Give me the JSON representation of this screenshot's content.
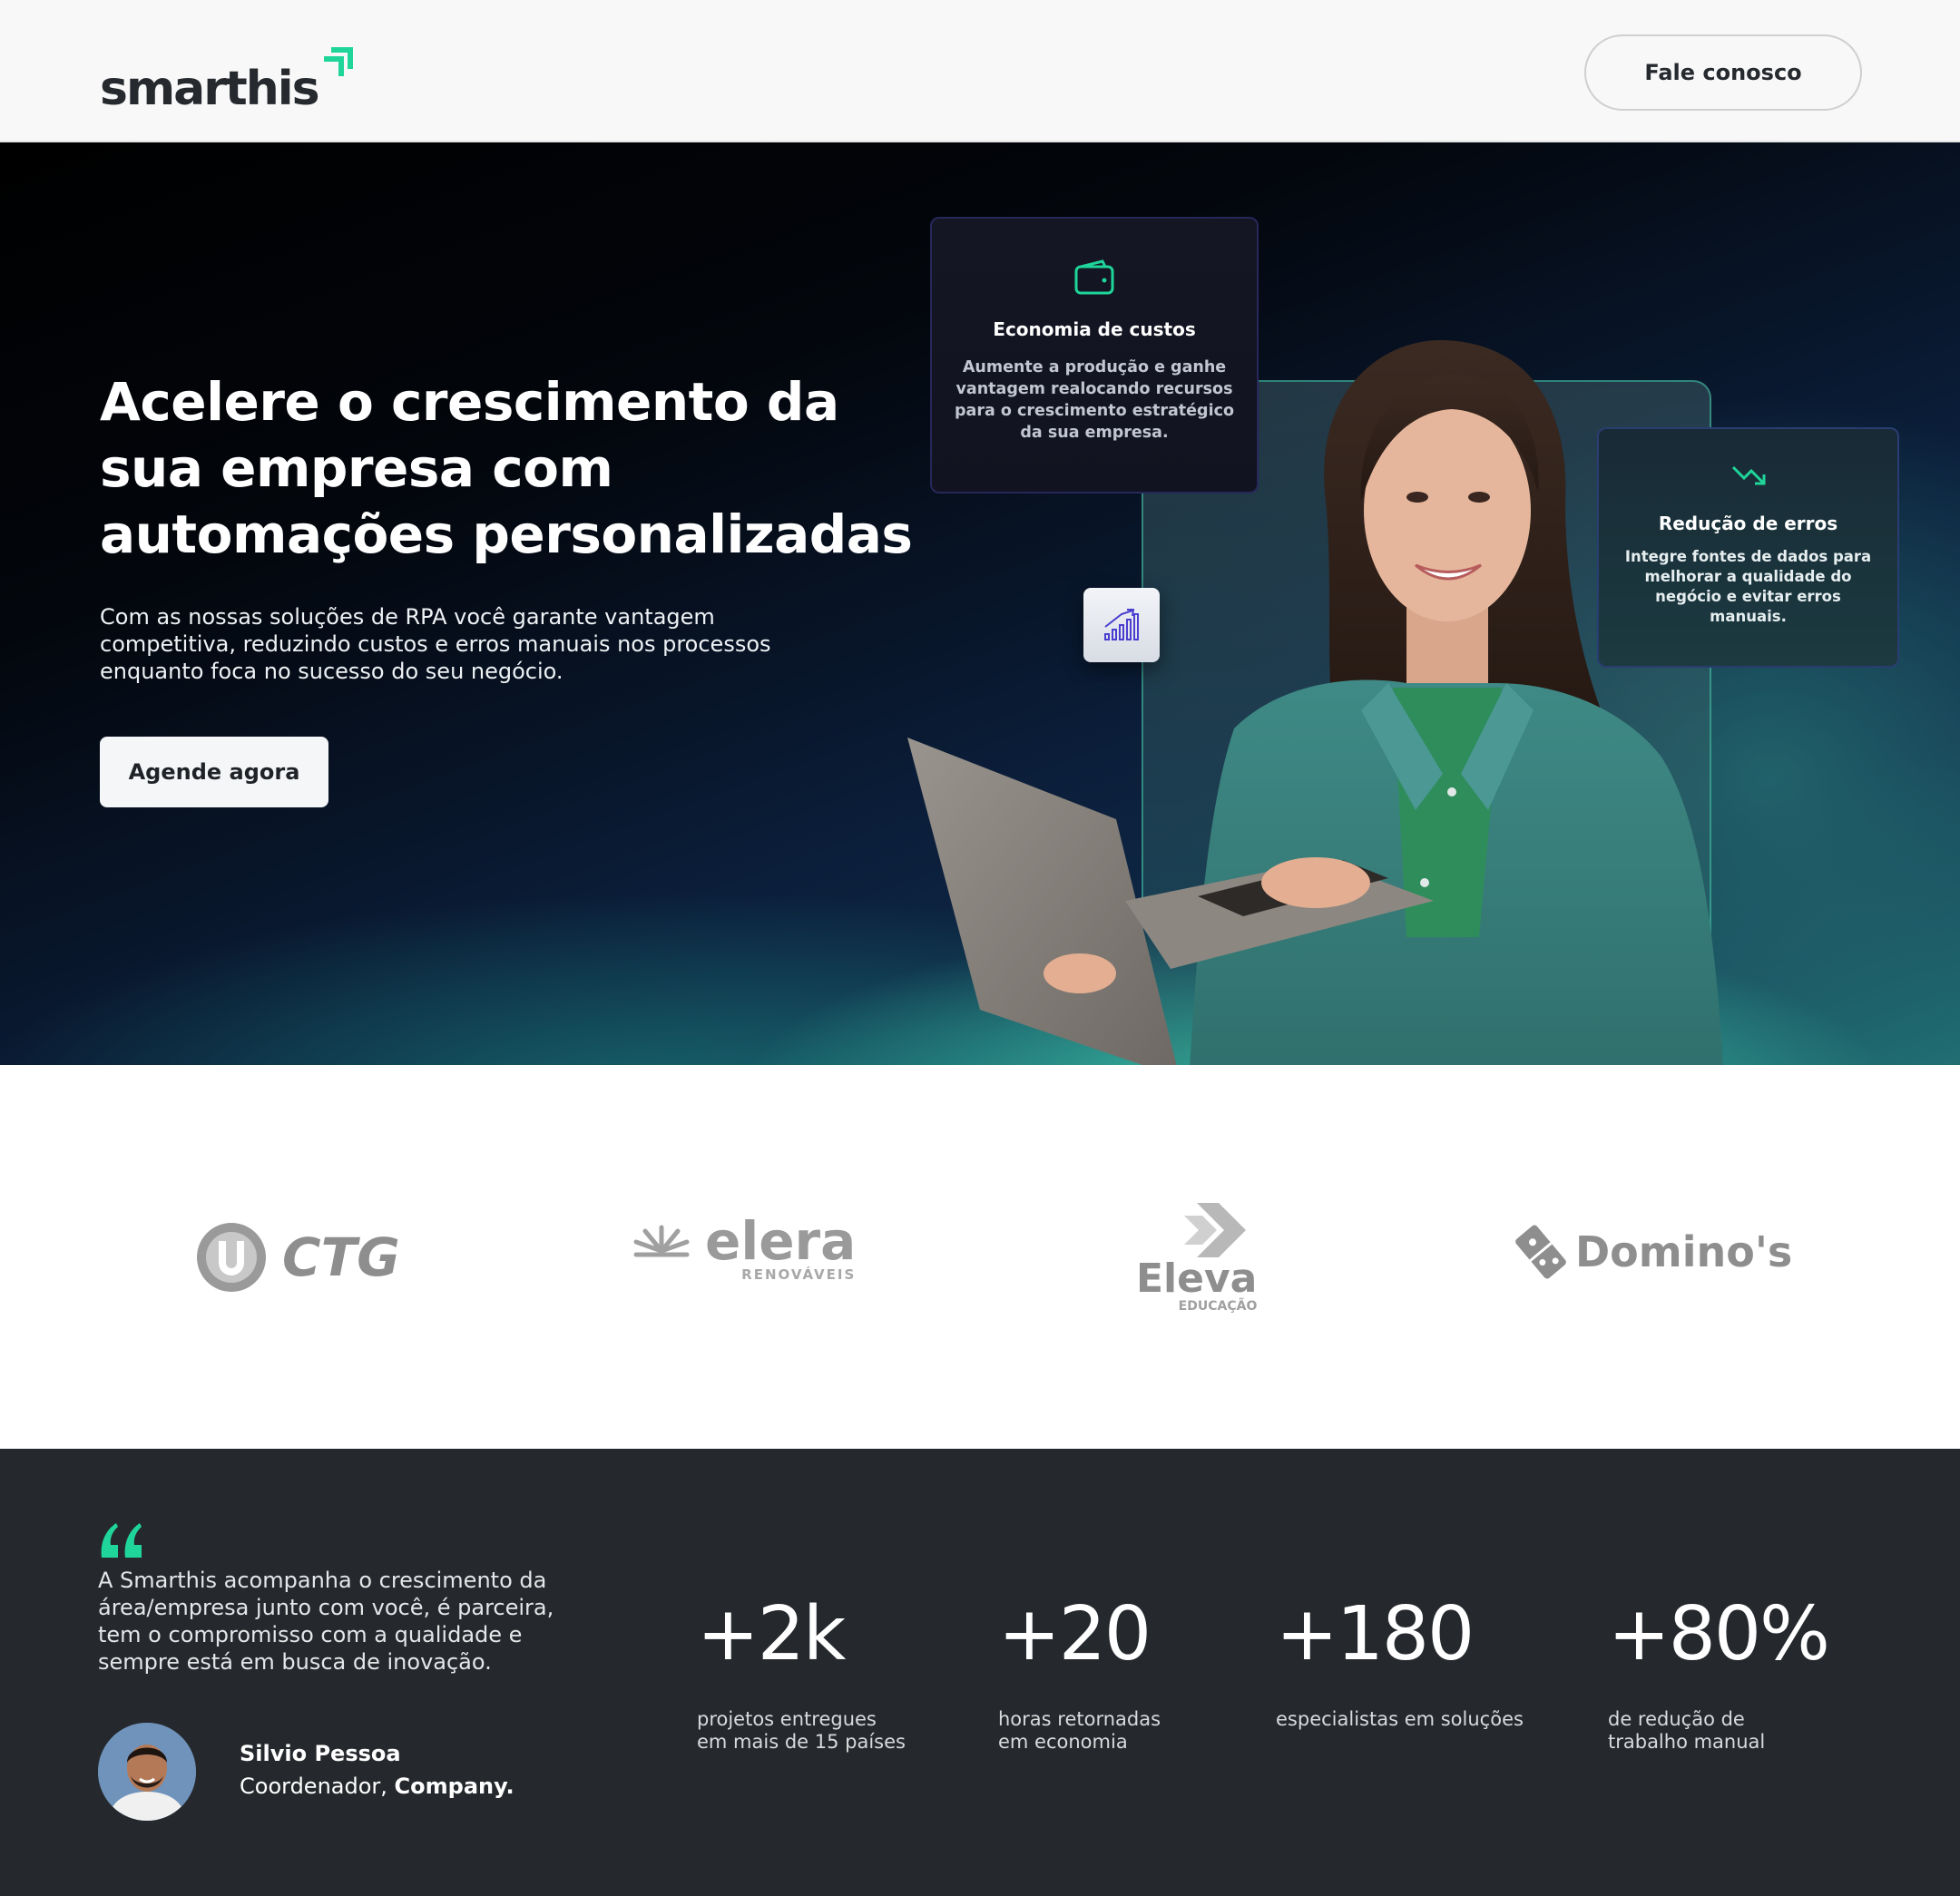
{
  "header": {
    "logo_text": "smarthis",
    "contact_label": "Fale conosco"
  },
  "hero": {
    "title": "Acelere o crescimento da sua empresa com automações personalizadas",
    "subtitle": "Com as nossas soluções de RPA você garante vantagem competitiva, reduzindo custos e erros manuais nos processos enquanto foca no sucesso do seu negócio.",
    "cta_label": "Agende agora",
    "cards": [
      {
        "icon": "wallet-icon",
        "title": "Economia de custos",
        "text": "Aumente a produção e ganhe vantagem realocando recursos para o crescimento estratégico da sua empresa."
      },
      {
        "icon": "trend-down-icon",
        "title": "Redução de erros",
        "text": "Integre fontes de dados para melhorar a qualidade do negócio e evitar erros manuais."
      }
    ],
    "badge_icon": "growth-chart-icon"
  },
  "clients": [
    {
      "name": "CTG",
      "sub": ""
    },
    {
      "name": "elera",
      "sub": "RENOVÁVEIS"
    },
    {
      "name": "Eleva",
      "sub": "EDUCAÇÃO"
    },
    {
      "name": "Domino's",
      "sub": ""
    }
  ],
  "testimonial": {
    "quote": "A Smarthis acompanha o crescimento da área/empresa junto com você, é parceira, tem o compromisso com a qualidade e sempre está em busca de inovação.",
    "author": "Silvio Pessoa",
    "role": "Coordenador, ",
    "company": "Company."
  },
  "stats": [
    {
      "value": "+2k",
      "label": "projetos entregues\nem mais de 15 países"
    },
    {
      "value": "+20",
      "label": "horas retornadas\nem economia"
    },
    {
      "value": "+180",
      "label": "especialistas em soluções"
    },
    {
      "value": "+80%",
      "label": "de redução de\ntrabalho manual"
    }
  ],
  "colors": {
    "accent": "#1fd59a",
    "dark": "#25292d",
    "header_bg": "#f8f8f8"
  }
}
